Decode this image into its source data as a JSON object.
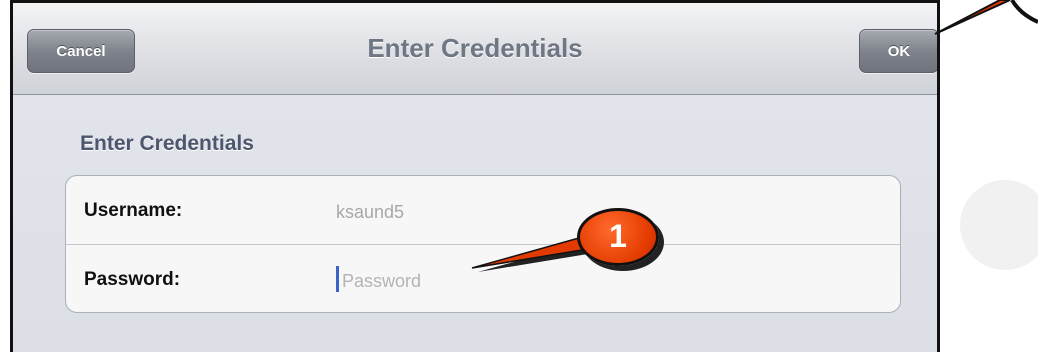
{
  "navbar": {
    "title": "Enter Credentials",
    "cancel_label": "Cancel",
    "ok_label": "OK"
  },
  "form": {
    "section_header": "Enter Credentials",
    "username": {
      "label": "Username:",
      "value": "ksaund5"
    },
    "password": {
      "label": "Password:",
      "placeholder": "Password"
    }
  },
  "callout": {
    "number": "1",
    "color": "#e33a00"
  }
}
